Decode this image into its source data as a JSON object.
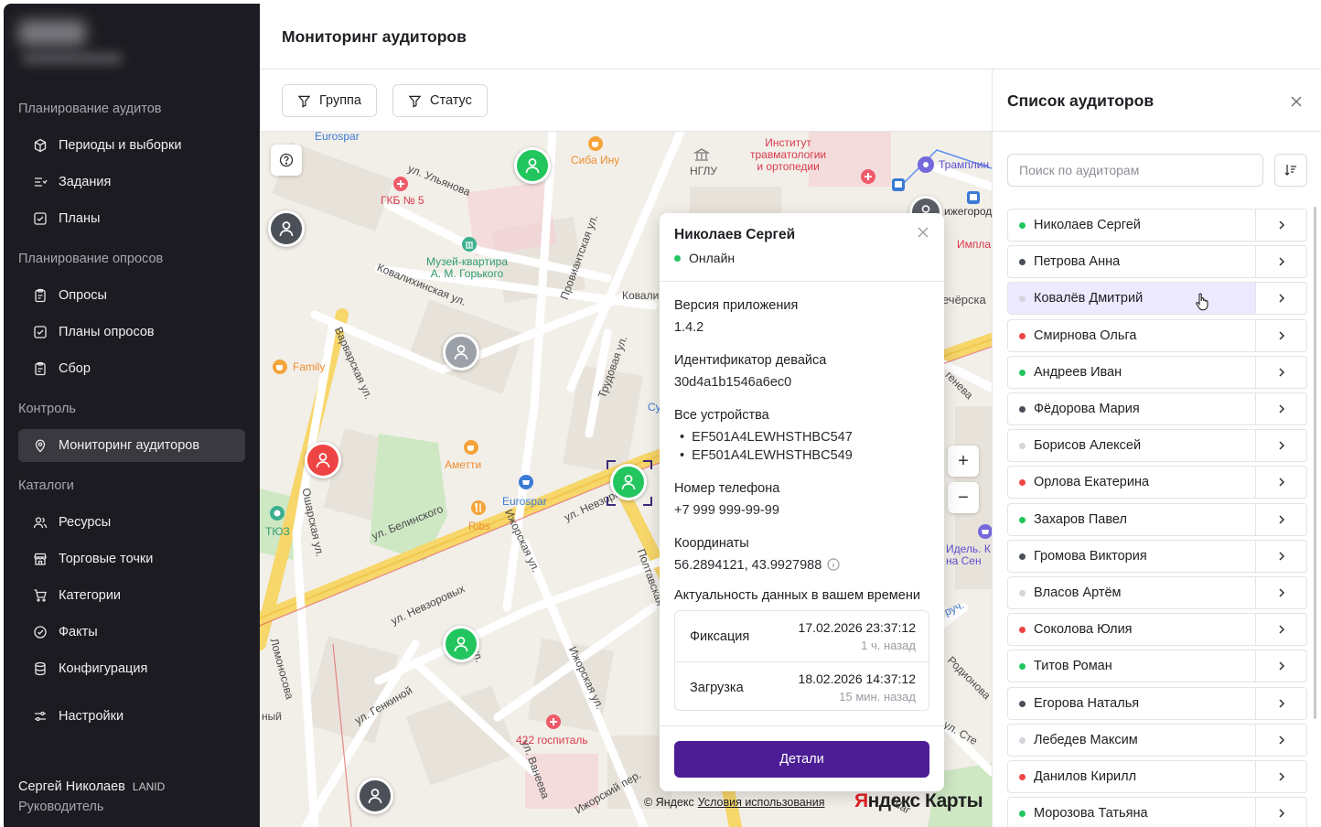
{
  "sidebar": {
    "sections": [
      {
        "title": "Планирование аудитов"
      },
      {
        "title": "Планирование опросов"
      },
      {
        "title": "Контроль"
      },
      {
        "title": "Каталоги"
      }
    ],
    "items": [
      {
        "label": "Периоды и выборки",
        "icon": "cube-icon"
      },
      {
        "label": "Задания",
        "icon": "tasks-icon"
      },
      {
        "label": "Планы",
        "icon": "checkbox-icon"
      },
      {
        "label": "Опросы",
        "icon": "clipboard-icon"
      },
      {
        "label": "Планы опросов",
        "icon": "checkbox-icon"
      },
      {
        "label": "Сбор",
        "icon": "clipboard-icon"
      },
      {
        "label": "Мониторинг аудиторов",
        "icon": "location-pin-icon"
      },
      {
        "label": "Ресурсы",
        "icon": "users-icon"
      },
      {
        "label": "Торговые точки",
        "icon": "store-icon"
      },
      {
        "label": "Категории",
        "icon": "cart-icon"
      },
      {
        "label": "Факты",
        "icon": "check-circle-icon"
      },
      {
        "label": "Конфигурация",
        "icon": "database-icon"
      },
      {
        "label": "Настройки",
        "icon": "sliders-icon"
      }
    ],
    "user": {
      "name": "Сергей Николаев",
      "tag": "LANID",
      "role": "Руководитель"
    }
  },
  "header": {
    "title": "Мониторинг аудиторов"
  },
  "filters": {
    "group": "Группа",
    "status": "Статус"
  },
  "map": {
    "streets": {
      "ulyanova": "ул. Ульянова",
      "kovalikhinskaya": "Ковалихинская ул.",
      "kovali": "Ковали",
      "varvarskaya": "Варварская ул.",
      "belinskogo": "ул. Белинского",
      "provianstkaya": "Провиантская ул.",
      "trudovaya": "Трудовая ул.",
      "oshapskaya": "Ошарская ул.",
      "izhorskaya": "Ижорская ул.",
      "izhorskaya2": "Ижорская ул.",
      "nevzorovykh": "ул. Невзоровых",
      "nevzorovykh2": "ул. Невзоров",
      "genkinoy": "ул. Генкиной",
      "vaneeva": "ул. Ванеева",
      "ulitsa": "ул.",
      "poltavskaya": "Полтавская",
      "izhorsky": "Ижорский пер.",
      "lomonosova": "Ломоносова",
      "rodionova": "Родионова",
      "chorskaya": "ечёрска",
      "genova": "генева",
      "ste": "ул. Сте",
      "ruch": "руч.",
      "ny": "ный",
      "shag": "Шаг"
    },
    "pois": {
      "eurospar_top": "Eurospar",
      "siba": "Сиба Ину",
      "institute": "Институт\nтравматологии\nи ортопедии",
      "nglu": "НГЛУ",
      "tramline": "Трамплин",
      "nizhegorod": "ижегород",
      "impla": "Импла",
      "gkb5": "ГКБ № 5",
      "museum": "Музей-квартира\nА. М. Горького",
      "family": "Family",
      "ameretti": "Аметти",
      "eurospar": "Eurospar",
      "ribs": "Ribs",
      "tyuz": "ТЮЗ",
      "hospital": "422 госпиталь",
      "idel": "Идель. К\nна Сен",
      "su": "Су"
    },
    "copyright": "© Яндекс",
    "terms": "Условия использования",
    "logo_red": "Я",
    "logo_rest": "ндекс Карты",
    "zoom_in": "+",
    "zoom_out": "−",
    "markers": [
      {
        "status": "green"
      },
      {
        "status": "dark"
      },
      {
        "status": "gray"
      },
      {
        "status": "red"
      },
      {
        "status": "green"
      },
      {
        "status": "green"
      },
      {
        "status": "dark"
      }
    ]
  },
  "popup": {
    "title": "Николаев Сергей",
    "status": "Онлайн",
    "app_version_label": "Версия приложения",
    "app_version": "1.4.2",
    "device_id_label": "Идентификатор девайса",
    "device_id": "30d4a1b1546a6ec0",
    "devices_label": "Все устройства",
    "devices": [
      "EF501A4LEWHSTHBC547",
      "EF501A4LEWHSTHBC549"
    ],
    "phone_label": "Номер телефона",
    "phone": "+7 999 999-99-99",
    "coords_label": "Координаты",
    "coords": "56.2894121, 43.9927988",
    "freshness_label": "Актуальность данных в вашем времени",
    "fix_label": "Фиксация",
    "fix_date": "17.02.2026 23:37:12",
    "fix_ago": "1 ч. назад",
    "upload_label": "Загрузка",
    "upload_date": "18.02.2026 14:37:12",
    "upload_ago": "15 мин. назад",
    "details_button": "Детали"
  },
  "panel": {
    "title": "Список аудиторов",
    "search_placeholder": "Поиск по аудиторам",
    "status_colors": {
      "green": "#22c55e",
      "dark": "#4b4f57",
      "gray": "#d4d4da",
      "red": "#ef4444"
    },
    "auditors": [
      {
        "name": "Николаев Сергей",
        "status": "green"
      },
      {
        "name": "Петрова Анна",
        "status": "dark"
      },
      {
        "name": "Ковалёв Дмитрий",
        "status": "gray"
      },
      {
        "name": "Смирнова Ольга",
        "status": "red"
      },
      {
        "name": "Андреев Иван",
        "status": "green"
      },
      {
        "name": "Фёдорова Мария",
        "status": "dark"
      },
      {
        "name": "Борисов Алексей",
        "status": "gray"
      },
      {
        "name": "Орлова Екатерина",
        "status": "red"
      },
      {
        "name": "Захаров Павел",
        "status": "green"
      },
      {
        "name": "Громова Виктория",
        "status": "dark"
      },
      {
        "name": "Власов Артём",
        "status": "gray"
      },
      {
        "name": "Соколова Юлия",
        "status": "red"
      },
      {
        "name": "Титов Роман",
        "status": "green"
      },
      {
        "name": "Егорова Наталья",
        "status": "dark"
      },
      {
        "name": "Лебедев Максим",
        "status": "gray"
      },
      {
        "name": "Данилов Кирилл",
        "status": "red"
      },
      {
        "name": "Морозова Татьяна",
        "status": "green"
      }
    ]
  }
}
